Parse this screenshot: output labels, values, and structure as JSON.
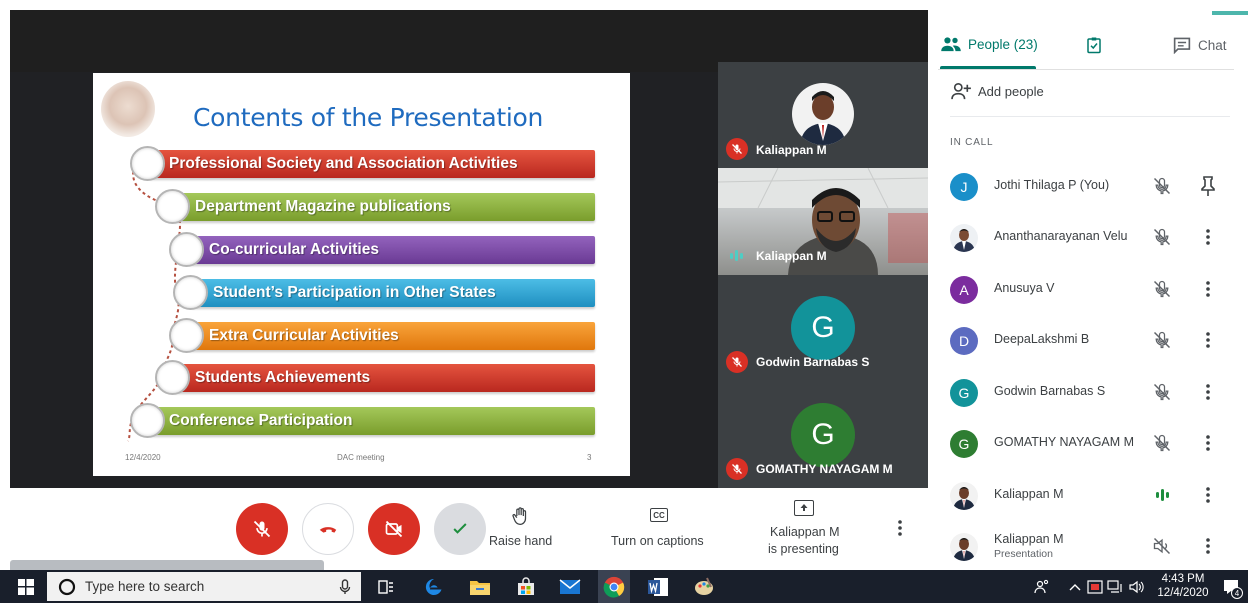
{
  "slide": {
    "title": "Contents of the Presentation",
    "items": [
      {
        "label": "Professional Society and Association Activities",
        "color": "#d23b2c"
      },
      {
        "label": "Department Magazine publications",
        "color": "#8cb03a"
      },
      {
        "label": "Co-curricular Activities",
        "color": "#7a48a4"
      },
      {
        "label": "Student’s Participation in Other States",
        "color": "#2ea6d6"
      },
      {
        "label": "Extra Curricular Activities",
        "color": "#f28c1a"
      },
      {
        "label": "Students Achievements",
        "color": "#d23b2c"
      },
      {
        "label": "Conference Participation",
        "color": "#8cb03a"
      }
    ],
    "footer_date": "12/4/2020",
    "footer_center": "DAC meeting",
    "footer_page": "3"
  },
  "tiles": [
    {
      "name": "Kaliappan M",
      "muted": true
    },
    {
      "name": "Kaliappan M",
      "speaking": true
    },
    {
      "name": "Godwin Barnabas S",
      "initial": "G",
      "color": "#12939a",
      "muted": true
    },
    {
      "name": "GOMATHY NAYAGAM M",
      "initial": "G",
      "color": "#2e7d32",
      "muted": true
    }
  ],
  "controls": {
    "raise_hand": "Raise hand",
    "captions": "Turn on captions",
    "presenting_line1": "Kaliappan M",
    "presenting_line2": "is presenting",
    "captions_icon": "CC"
  },
  "panel": {
    "tab_people": "People (23)",
    "tab_chat": "Chat",
    "add_people": "Add people",
    "in_call": "IN CALL",
    "participants": [
      {
        "name": "Jothi Thilaga P (You)",
        "initial": "J",
        "color": "#1a8fc9",
        "status": "muted",
        "action": "pin-icon"
      },
      {
        "name": "Ananthanarayanan Velu",
        "photo": true,
        "status": "muted",
        "action": "more-icon"
      },
      {
        "name": "Anusuya V",
        "initial": "A",
        "color": "#7b2c9e",
        "status": "muted",
        "action": "more-icon"
      },
      {
        "name": "DeepaLakshmi B",
        "initial": "D",
        "color": "#5c6bc0",
        "status": "muted",
        "action": "more-icon"
      },
      {
        "name": "Godwin Barnabas S",
        "initial": "G",
        "color": "#12939a",
        "status": "muted",
        "action": "more-icon"
      },
      {
        "name": "GOMATHY NAYAGAM M",
        "initial": "G",
        "color": "#2e7d32",
        "status": "muted",
        "action": "more-icon"
      },
      {
        "name": "Kaliappan M",
        "photo": true,
        "status": "speaking",
        "action": "more-icon"
      },
      {
        "name": "Kaliappan M",
        "sub": "Presentation",
        "photo": true,
        "status": "audio-muted",
        "action": "more-icon"
      }
    ]
  },
  "taskbar": {
    "search_placeholder": "Type here to search",
    "time": "4:43 PM",
    "date": "12/4/2020",
    "notification_count": "4"
  }
}
